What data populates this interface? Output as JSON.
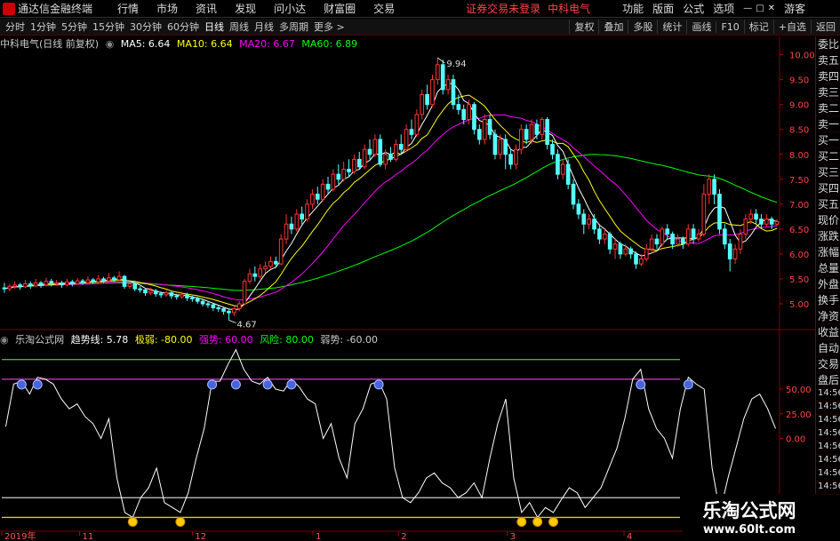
{
  "window": {
    "title": "通达信金融终端",
    "menus": [
      "行情",
      "市场",
      "资讯",
      "发现",
      "问小达",
      "财富圈",
      "交易"
    ],
    "notice": "证券交易未登录",
    "stock_badge": "中科电气",
    "right_menus": [
      "功能",
      "版面",
      "公式",
      "选项"
    ],
    "user": "游客"
  },
  "toolbar": {
    "periods": [
      "分时",
      "1分钟",
      "5分钟",
      "15分钟",
      "30分钟",
      "60分钟",
      "日线",
      "周线",
      "月线",
      "多周期",
      "更多 >"
    ],
    "active_period": "日线",
    "right_buttons": [
      "复权",
      "叠加",
      "多股",
      "统计",
      "画线",
      "F10",
      "标记",
      "+自选",
      "返回"
    ]
  },
  "main_legend": {
    "name": "中科电气(日线 前复权)",
    "ma5": "MA5: 6.64",
    "ma10": "MA10: 6.64",
    "ma20": "MA20: 6.67",
    "ma60": "MA60: 6.89"
  },
  "sub_legend": {
    "name": "乐淘公式网",
    "trend": "趋势线: 5.78",
    "weak": "极弱: -80.00",
    "strong": "强势: 60.00",
    "risk": "风险: 80.00",
    "weakness": "弱势: -60.00"
  },
  "price_axis": [
    "10.00",
    "9.50",
    "9.00",
    "8.50",
    "8.00",
    "7.50",
    "7.00",
    "6.50",
    "6.00",
    "5.50",
    "5.00"
  ],
  "sub_axis": [
    "50.00",
    "25.00",
    "0.00"
  ],
  "side_labels": [
    "委比",
    "卖五",
    "卖四",
    "卖三",
    "卖二",
    "卖一",
    "买一",
    "买二",
    "买三",
    "买四",
    "买五",
    "现价",
    "涨跌",
    "涨幅",
    "总量",
    "外盘",
    "换手",
    "净资",
    "收益",
    "自动",
    "交易",
    "盘后",
    "14:56",
    "14:56",
    "14:56",
    "14:56",
    "14:56",
    "14:56",
    "14:56",
    "14:56"
  ],
  "x_labels": [
    "2019年",
    "11",
    "12",
    "1",
    "2",
    "3",
    "4"
  ],
  "annotations": {
    "high": "9.94",
    "low": "4.67"
  },
  "watermark": {
    "line1": "乐淘公式网",
    "line2": "www.60lt.com"
  },
  "colors": {
    "ma5": "#ffffff",
    "ma10": "#ffff00",
    "ma20": "#ff00ff",
    "ma60": "#00ff00",
    "up": "#ff3333",
    "down": "#54ffff",
    "strong_line": "#cc44cc",
    "risk_line": "#33bb33",
    "weak_line": "#cccccc",
    "extreme_weak_line": "#cccc33"
  },
  "chart_data": {
    "type": "candlestick",
    "ylim": [
      4.5,
      10.1
    ],
    "sub_ylim": [
      -85,
      95
    ],
    "candles": [
      [
        5.32,
        5.3,
        5.42,
        5.22
      ],
      [
        5.3,
        5.35,
        5.4,
        5.25
      ],
      [
        5.35,
        5.38,
        5.45,
        5.3
      ],
      [
        5.38,
        5.34,
        5.42,
        5.28
      ],
      [
        5.34,
        5.4,
        5.48,
        5.32
      ],
      [
        5.4,
        5.36,
        5.45,
        5.3
      ],
      [
        5.36,
        5.42,
        5.5,
        5.33
      ],
      [
        5.42,
        5.38,
        5.46,
        5.32
      ],
      [
        5.38,
        5.45,
        5.52,
        5.35
      ],
      [
        5.45,
        5.4,
        5.5,
        5.35
      ],
      [
        5.4,
        5.42,
        5.48,
        5.36
      ],
      [
        5.42,
        5.38,
        5.46,
        5.32
      ],
      [
        5.38,
        5.44,
        5.5,
        5.35
      ],
      [
        5.44,
        5.4,
        5.48,
        5.35
      ],
      [
        5.4,
        5.46,
        5.52,
        5.38
      ],
      [
        5.46,
        5.42,
        5.5,
        5.38
      ],
      [
        5.42,
        5.48,
        5.55,
        5.4
      ],
      [
        5.48,
        5.44,
        5.52,
        5.4
      ],
      [
        5.44,
        5.5,
        5.58,
        5.42
      ],
      [
        5.5,
        5.46,
        5.54,
        5.42
      ],
      [
        5.46,
        5.52,
        5.62,
        5.44
      ],
      [
        5.52,
        5.48,
        5.56,
        5.44
      ],
      [
        5.48,
        5.55,
        5.65,
        5.46
      ],
      [
        5.55,
        5.35,
        5.58,
        5.3
      ],
      [
        5.35,
        5.4,
        5.45,
        5.3
      ],
      [
        5.4,
        5.3,
        5.44,
        5.25
      ],
      [
        5.3,
        5.28,
        5.35,
        5.22
      ],
      [
        5.28,
        5.22,
        5.32,
        5.16
      ],
      [
        5.22,
        5.26,
        5.32,
        5.18
      ],
      [
        5.26,
        5.2,
        5.3,
        5.14
      ],
      [
        5.2,
        5.18,
        5.25,
        5.12
      ],
      [
        5.18,
        5.22,
        5.28,
        5.14
      ],
      [
        5.22,
        5.16,
        5.26,
        5.1
      ],
      [
        5.16,
        5.14,
        5.2,
        5.08
      ],
      [
        5.14,
        5.18,
        5.24,
        5.1
      ],
      [
        5.18,
        5.12,
        5.22,
        5.06
      ],
      [
        5.12,
        5.1,
        5.16,
        5.04
      ],
      [
        5.1,
        5.05,
        5.14,
        5.0
      ],
      [
        5.05,
        5.0,
        5.1,
        4.95
      ],
      [
        5.0,
        4.98,
        5.04,
        4.92
      ],
      [
        4.98,
        4.92,
        5.02,
        4.86
      ],
      [
        4.92,
        4.9,
        4.96,
        4.84
      ],
      [
        4.9,
        4.85,
        4.94,
        4.78
      ],
      [
        4.85,
        4.82,
        4.9,
        4.67
      ],
      [
        4.82,
        4.9,
        4.95,
        4.75
      ],
      [
        4.9,
        5.0,
        5.05,
        4.85
      ],
      [
        5.0,
        5.45,
        5.5,
        4.98
      ],
      [
        5.45,
        5.6,
        5.7,
        5.4
      ],
      [
        5.6,
        5.55,
        5.75,
        5.45
      ],
      [
        5.55,
        5.7,
        5.8,
        5.5
      ],
      [
        5.7,
        5.75,
        5.85,
        5.62
      ],
      [
        5.75,
        5.85,
        5.95,
        5.7
      ],
      [
        5.85,
        5.8,
        5.95,
        5.72
      ],
      [
        5.8,
        6.3,
        6.4,
        5.78
      ],
      [
        6.3,
        6.6,
        6.8,
        6.2
      ],
      [
        6.6,
        6.5,
        6.75,
        6.4
      ],
      [
        6.5,
        6.8,
        6.9,
        6.45
      ],
      [
        6.8,
        6.7,
        6.95,
        6.6
      ],
      [
        6.7,
        7.0,
        7.1,
        6.65
      ],
      [
        7.0,
        7.2,
        7.3,
        6.9
      ],
      [
        7.2,
        7.1,
        7.35,
        7.0
      ],
      [
        7.1,
        7.4,
        7.5,
        7.05
      ],
      [
        7.4,
        7.3,
        7.55,
        7.2
      ],
      [
        7.3,
        7.6,
        7.7,
        7.25
      ],
      [
        7.6,
        7.5,
        7.8,
        7.4
      ],
      [
        7.5,
        7.7,
        7.85,
        7.45
      ],
      [
        7.7,
        7.65,
        7.9,
        7.55
      ],
      [
        7.65,
        7.9,
        8.0,
        7.6
      ],
      [
        7.9,
        7.75,
        8.05,
        7.7
      ],
      [
        7.75,
        8.1,
        8.2,
        7.7
      ],
      [
        8.1,
        8.0,
        8.3,
        7.9
      ],
      [
        8.0,
        8.3,
        8.4,
        7.95
      ],
      [
        8.3,
        7.8,
        8.4,
        7.75
      ],
      [
        7.8,
        8.0,
        8.1,
        7.7
      ],
      [
        8.0,
        7.9,
        8.15,
        7.85
      ],
      [
        7.9,
        8.2,
        8.3,
        7.85
      ],
      [
        8.2,
        8.1,
        8.4,
        8.0
      ],
      [
        8.1,
        8.5,
        8.6,
        8.05
      ],
      [
        8.5,
        8.4,
        8.7,
        8.3
      ],
      [
        8.4,
        8.8,
        8.9,
        8.35
      ],
      [
        8.8,
        9.2,
        9.3,
        8.7
      ],
      [
        9.2,
        9.0,
        9.4,
        8.9
      ],
      [
        9.0,
        9.5,
        9.6,
        8.95
      ],
      [
        9.5,
        9.8,
        9.94,
        9.4
      ],
      [
        9.8,
        9.3,
        9.9,
        9.2
      ],
      [
        9.3,
        9.5,
        9.6,
        9.2
      ],
      [
        9.5,
        9.0,
        9.6,
        8.9
      ],
      [
        9.0,
        8.9,
        9.2,
        8.8
      ],
      [
        8.9,
        8.7,
        9.0,
        8.6
      ],
      [
        8.7,
        9.0,
        9.1,
        8.6
      ],
      [
        9.0,
        8.5,
        9.05,
        8.4
      ],
      [
        8.5,
        8.3,
        8.6,
        8.2
      ],
      [
        8.3,
        8.7,
        8.8,
        8.2
      ],
      [
        8.7,
        8.4,
        8.8,
        8.3
      ],
      [
        8.4,
        8.0,
        8.5,
        7.9
      ],
      [
        8.0,
        8.3,
        8.4,
        7.9
      ],
      [
        8.3,
        8.0,
        8.4,
        7.7
      ],
      [
        8.0,
        7.8,
        8.1,
        7.7
      ],
      [
        7.8,
        8.1,
        8.2,
        7.7
      ],
      [
        8.1,
        8.5,
        8.6,
        8.0
      ],
      [
        8.5,
        8.3,
        8.6,
        8.2
      ],
      [
        8.3,
        8.6,
        8.7,
        8.2
      ],
      [
        8.6,
        8.4,
        8.7,
        8.3
      ],
      [
        8.4,
        8.7,
        8.75,
        8.3
      ],
      [
        8.7,
        8.2,
        8.75,
        8.1
      ],
      [
        8.2,
        8.0,
        8.3,
        7.9
      ],
      [
        8.0,
        7.6,
        8.1,
        7.5
      ],
      [
        7.6,
        7.8,
        7.9,
        7.5
      ],
      [
        7.8,
        7.4,
        7.9,
        7.3
      ],
      [
        7.4,
        7.0,
        7.5,
        6.9
      ],
      [
        7.0,
        6.8,
        7.1,
        6.7
      ],
      [
        6.8,
        6.6,
        6.9,
        6.4
      ],
      [
        6.6,
        6.7,
        6.8,
        6.5
      ],
      [
        6.7,
        6.5,
        6.8,
        6.4
      ],
      [
        6.5,
        6.3,
        6.6,
        6.2
      ],
      [
        6.3,
        6.4,
        6.5,
        6.2
      ],
      [
        6.4,
        6.1,
        6.45,
        6.0
      ],
      [
        6.1,
        6.2,
        6.3,
        5.9
      ],
      [
        6.2,
        6.0,
        6.25,
        5.9
      ],
      [
        6.0,
        6.1,
        6.2,
        5.95
      ],
      [
        6.1,
        6.0,
        6.15,
        5.9
      ],
      [
        6.0,
        5.8,
        6.05,
        5.7
      ],
      [
        5.8,
        5.9,
        6.0,
        5.75
      ],
      [
        5.9,
        6.1,
        6.2,
        5.85
      ],
      [
        6.1,
        6.3,
        6.4,
        6.0
      ],
      [
        6.3,
        6.2,
        6.4,
        6.1
      ],
      [
        6.2,
        6.5,
        6.55,
        6.15
      ],
      [
        6.5,
        6.4,
        6.6,
        6.3
      ],
      [
        6.4,
        6.2,
        6.45,
        6.1
      ],
      [
        6.2,
        6.3,
        6.4,
        6.15
      ],
      [
        6.3,
        6.2,
        6.35,
        6.1
      ],
      [
        6.2,
        6.5,
        6.6,
        6.15
      ],
      [
        6.5,
        6.3,
        6.6,
        6.2
      ],
      [
        6.3,
        6.4,
        6.5,
        6.25
      ],
      [
        6.4,
        7.2,
        7.4,
        6.35
      ],
      [
        7.2,
        7.5,
        7.6,
        7.0
      ],
      [
        7.5,
        7.2,
        7.6,
        7.0
      ],
      [
        7.2,
        6.5,
        7.3,
        6.4
      ],
      [
        6.5,
        6.2,
        6.6,
        6.1
      ],
      [
        6.2,
        5.9,
        6.3,
        5.65
      ],
      [
        5.9,
        6.1,
        6.2,
        5.8
      ],
      [
        6.1,
        6.4,
        6.5,
        6.0
      ],
      [
        6.4,
        6.7,
        6.8,
        6.3
      ],
      [
        6.7,
        6.8,
        6.9,
        6.6
      ],
      [
        6.8,
        6.7,
        6.9,
        6.6
      ],
      [
        6.7,
        6.6,
        6.8,
        6.5
      ],
      [
        6.6,
        6.7,
        6.8,
        6.55
      ],
      [
        6.7,
        6.6,
        6.75,
        6.5
      ],
      [
        6.6,
        6.65,
        6.7,
        6.55
      ]
    ],
    "trend_values": [
      12,
      55,
      58,
      45,
      62,
      60,
      55,
      40,
      30,
      35,
      22,
      15,
      0,
      20,
      -40,
      -75,
      -80,
      -60,
      -50,
      -30,
      -65,
      -70,
      -75,
      -55,
      -20,
      10,
      58,
      58,
      75,
      90,
      70,
      58,
      55,
      62,
      50,
      48,
      60,
      52,
      40,
      35,
      0,
      15,
      -20,
      -40,
      15,
      30,
      55,
      58,
      40,
      -30,
      -60,
      -65,
      -55,
      -40,
      -35,
      -45,
      -50,
      -60,
      -55,
      -45,
      -60,
      -20,
      15,
      40,
      -40,
      -75,
      -65,
      -80,
      -70,
      -75,
      -62,
      -50,
      -55,
      -70,
      -60,
      -50,
      -30,
      -10,
      20,
      60,
      70,
      30,
      10,
      0,
      -20,
      30,
      62,
      55,
      50,
      -30,
      -75,
      -40,
      -10,
      20,
      40,
      45,
      30,
      10
    ],
    "levels": {
      "risk": 80,
      "strong": 60,
      "weak": -60,
      "extreme_weak": -80
    }
  }
}
